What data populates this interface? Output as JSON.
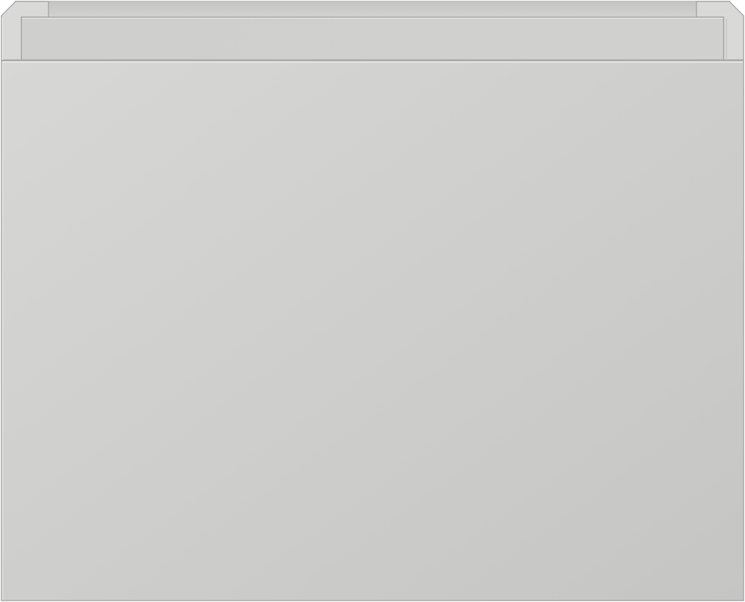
{
  "image": {
    "subject": "cabinet-drawer-front",
    "colors": {
      "background": "#ffffff",
      "front_light": "#d6d6d4",
      "front_dark": "#c6c6c4",
      "box_top": "#cfcfcd",
      "box_inner": "#c9c9c7",
      "box_side": "#d8d8d6",
      "edge_highlight": "#f2f2f0",
      "edge_shadow": "#a9a9a7"
    }
  }
}
